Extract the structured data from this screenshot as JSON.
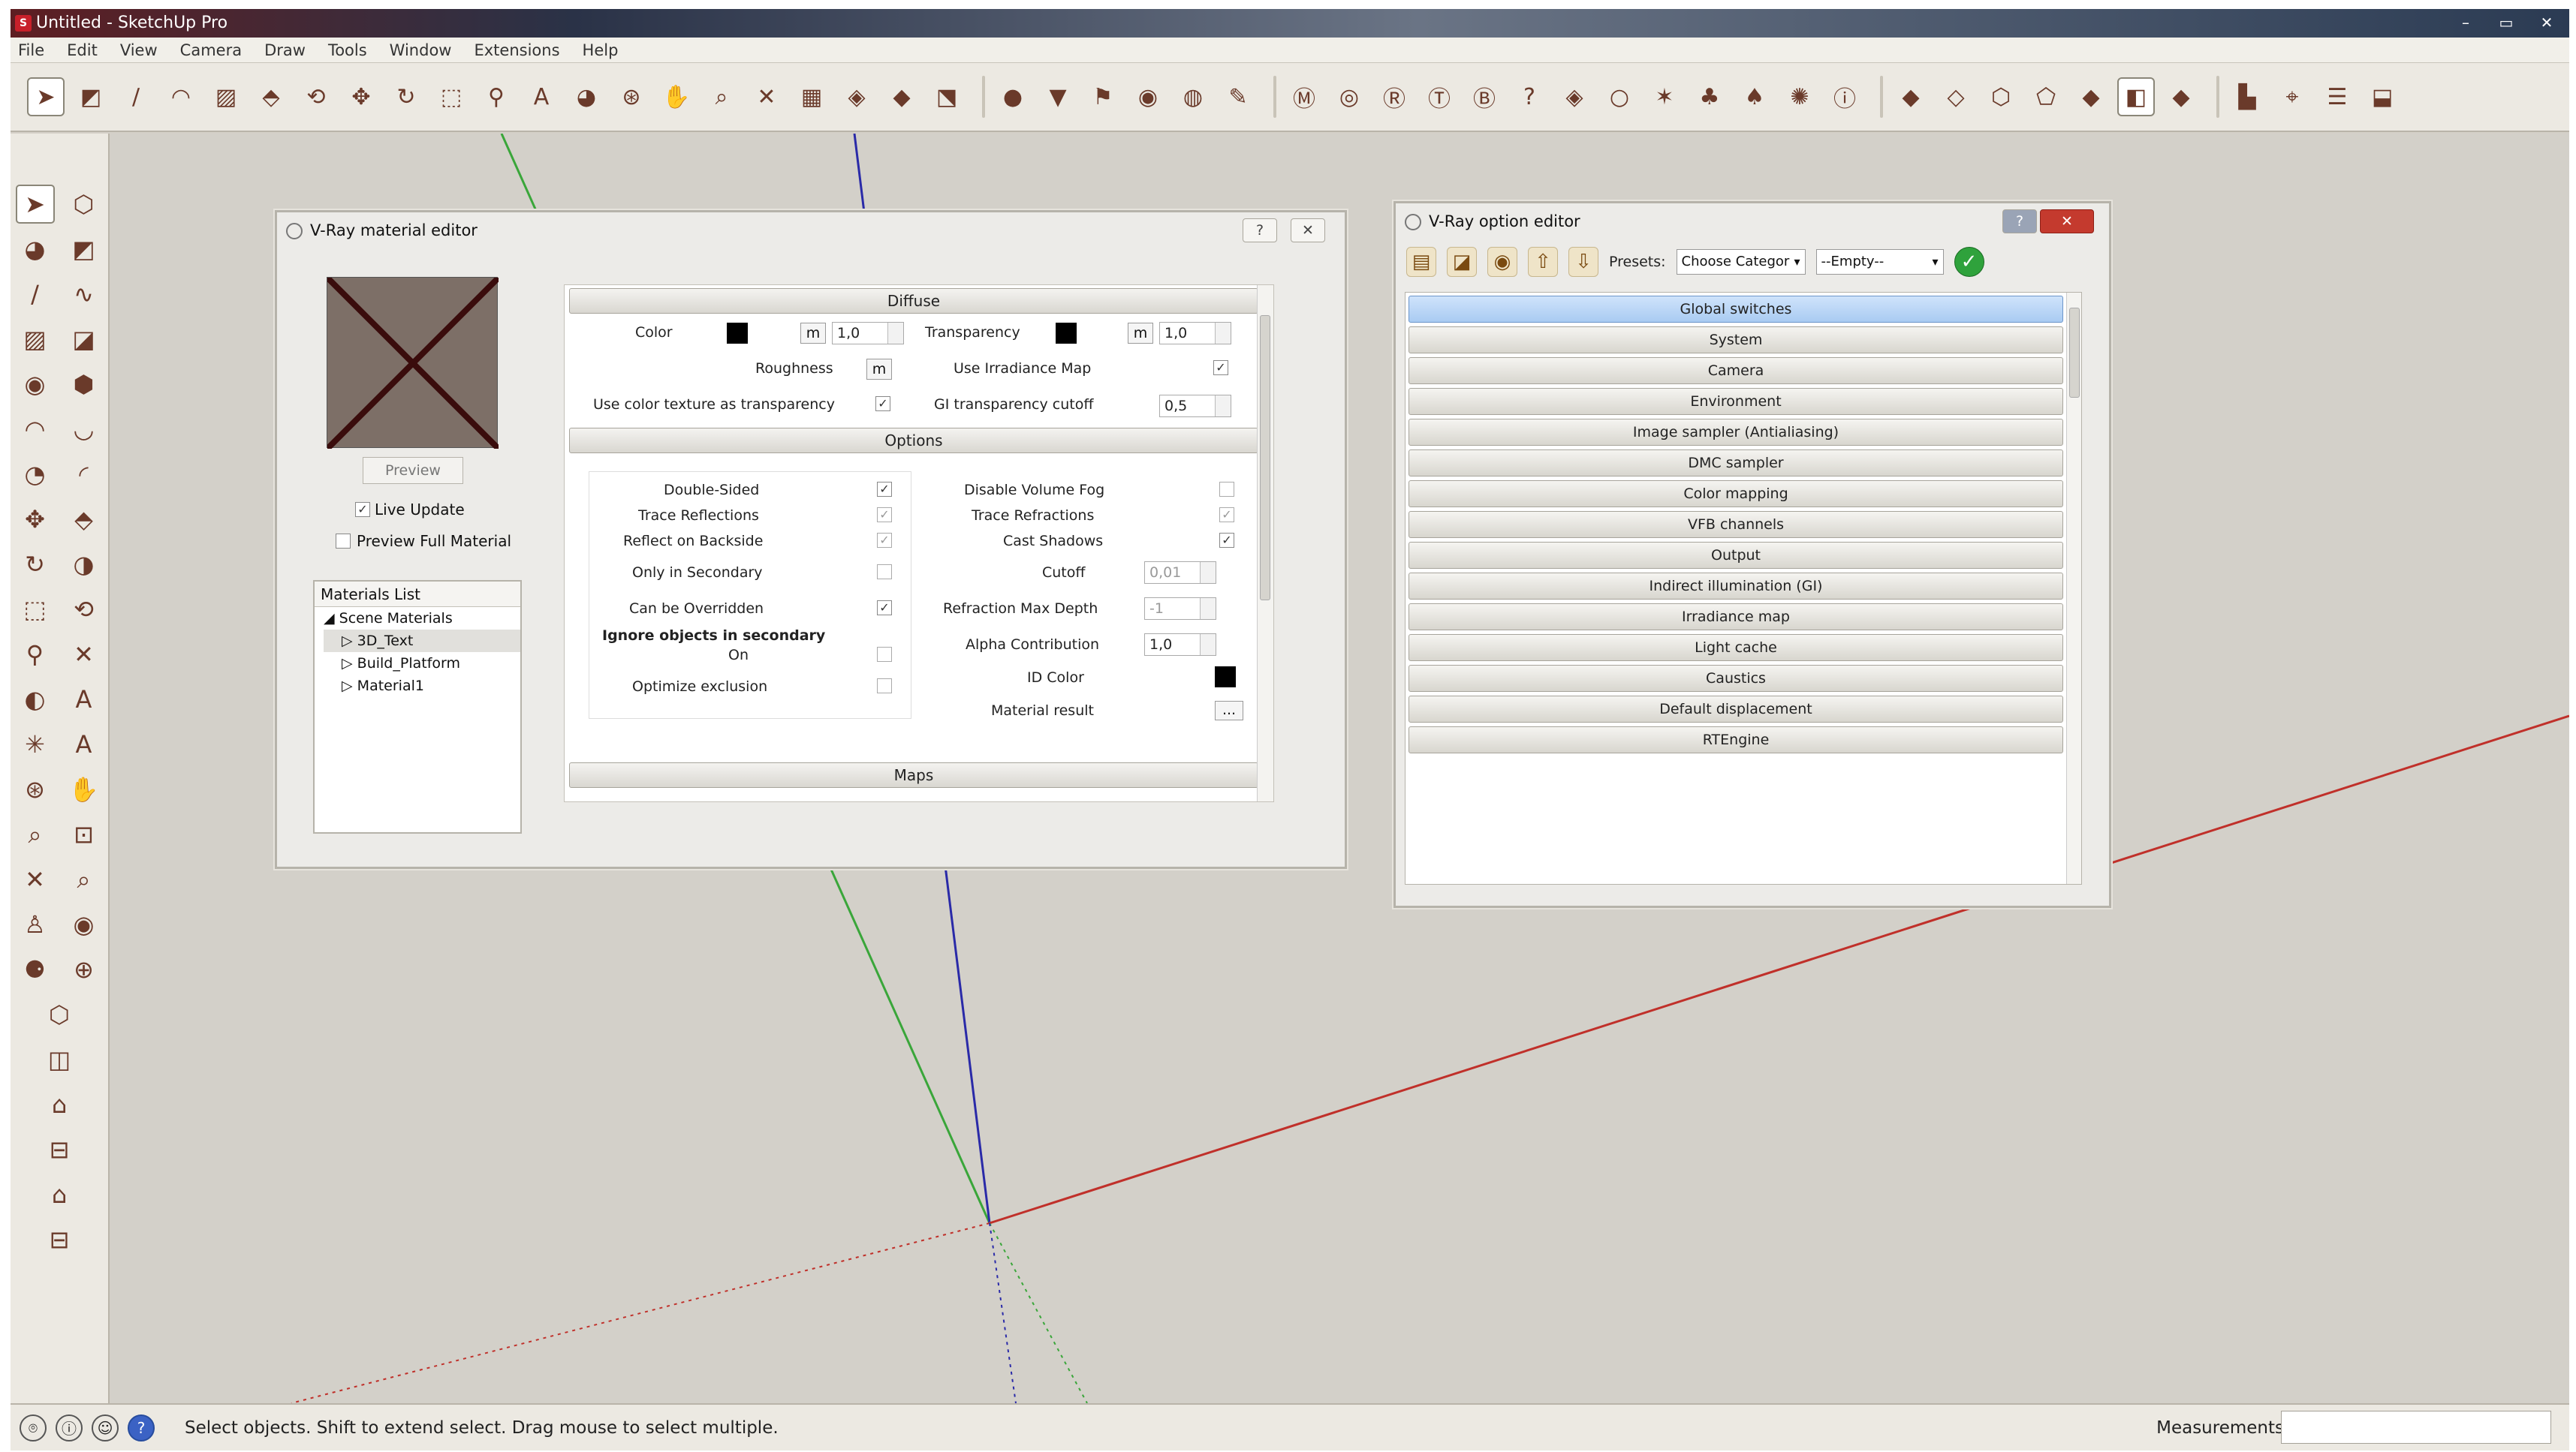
{
  "window": {
    "title": "Untitled - SketchUp Pro",
    "app_icon": "sketchup-icon"
  },
  "menu": [
    "File",
    "Edit",
    "View",
    "Camera",
    "Draw",
    "Tools",
    "Window",
    "Extensions",
    "Help"
  ],
  "status": {
    "text": "Select objects. Shift to extend select. Drag mouse to select multiple.",
    "measurements_label": "Measurements",
    "measurements_value": ""
  },
  "material_editor": {
    "title": "V-Ray material editor",
    "preview_button": "Preview",
    "live_update_label": "Live Update",
    "live_update_checked": true,
    "preview_full_label": "Preview Full Material",
    "preview_full_checked": false,
    "materials_list": {
      "header": "Materials List",
      "root": "Scene Materials",
      "items": [
        "3D_Text",
        "Build_Platform",
        "Material1"
      ],
      "selected": "3D_Text"
    },
    "diffuse": {
      "header": "Diffuse",
      "color_label": "Color",
      "color_value": "1,0",
      "transparency_label": "Transparency",
      "transparency_value": "1,0",
      "m_label": "m",
      "roughness_label": "Roughness",
      "use_irradiance_label": "Use Irradiance Map",
      "use_irradiance_checked": true,
      "use_color_texture_label": "Use color texture as transparency",
      "use_color_texture_checked": true,
      "gi_transparency_label": "GI transparency cutoff",
      "gi_transparency_value": "0,5"
    },
    "options": {
      "header": "Options",
      "double_sided": "Double-Sided",
      "trace_reflections": "Trace Reflections",
      "reflect_backside": "Reflect on Backside",
      "only_secondary": "Only in Secondary",
      "can_be_overridden": "Can be Overridden",
      "ignore_secondary": "Ignore objects in secondary",
      "on_label": "On",
      "optimize_exclusion": "Optimize exclusion",
      "disable_volume_fog": "Disable Volume Fog",
      "trace_refractions": "Trace Refractions",
      "cast_shadows": "Cast Shadows",
      "cutoff": "Cutoff",
      "cutoff_value": "0,01",
      "refraction_max_depth": "Refraction Max Depth",
      "refraction_max_depth_value": "-1",
      "alpha_contribution": "Alpha Contribution",
      "alpha_contribution_value": "1,0",
      "id_color": "ID Color",
      "material_result": "Material result",
      "material_result_button": "..."
    },
    "maps_header": "Maps"
  },
  "option_editor": {
    "title": "V-Ray option editor",
    "presets_label": "Presets:",
    "preset_category": "Choose Categor",
    "preset_value": "--Empty--",
    "items": [
      "Global switches",
      "System",
      "Camera",
      "Environment",
      "Image sampler (Antialiasing)",
      "DMC sampler",
      "Color mapping",
      "VFB channels",
      "Output",
      "Indirect illumination (GI)",
      "Irradiance map",
      "Light cache",
      "Caustics",
      "Default displacement",
      "RTEngine"
    ],
    "active": "Global switches"
  },
  "colors": {
    "x_axis": "#c0302a",
    "y_axis": "#3aa63a",
    "z_axis": "#2a2aa8",
    "viewport": "#d3d0c9"
  }
}
